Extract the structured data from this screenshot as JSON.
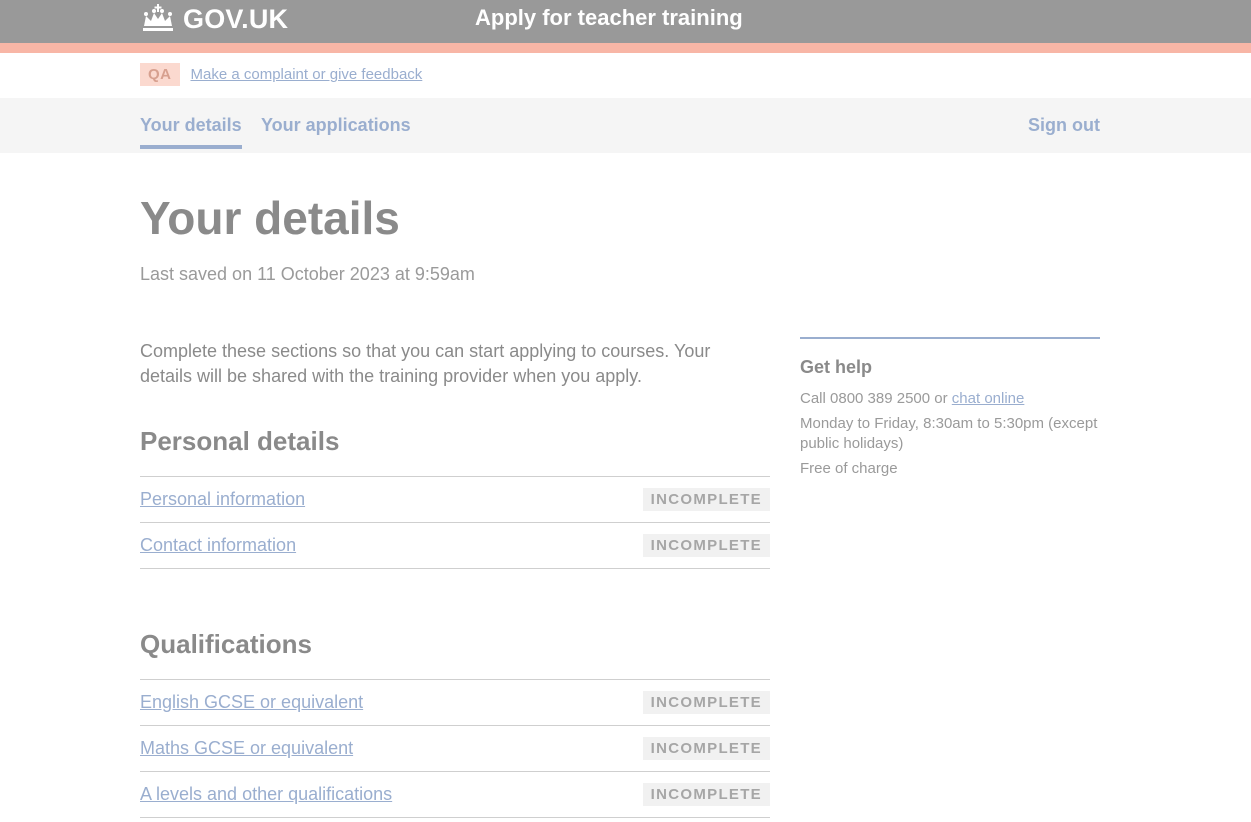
{
  "header": {
    "logo_text": "GOV.UK",
    "service_name": "Apply for teacher training",
    "crown_icon": "crown-icon"
  },
  "phase_banner": {
    "tag": "QA",
    "link": "Make a complaint or give feedback"
  },
  "nav": {
    "items": [
      {
        "label": "Your details",
        "active": true
      },
      {
        "label": "Your applications",
        "active": false
      }
    ],
    "sign_out": "Sign out"
  },
  "page": {
    "title": "Your details",
    "last_saved": "Last saved on 11 October 2023 at 9:59am",
    "intro": "Complete these sections so that you can start applying to courses. Your details will be shared with the training provider when you apply."
  },
  "sections": [
    {
      "heading": "Personal details",
      "tasks": [
        {
          "label": "Personal information",
          "status": "INCOMPLETE"
        },
        {
          "label": "Contact information",
          "status": "INCOMPLETE"
        }
      ]
    },
    {
      "heading": "Qualifications",
      "tasks": [
        {
          "label": "English GCSE or equivalent",
          "status": "INCOMPLETE"
        },
        {
          "label": "Maths GCSE or equivalent",
          "status": "INCOMPLETE"
        },
        {
          "label": "A levels and other qualifications",
          "status": "INCOMPLETE"
        }
      ]
    }
  ],
  "help": {
    "title": "Get help",
    "call_prefix": "Call 0800 389 2500 or",
    "chat_link": "chat online",
    "hours": "Monday to Friday, 8:30am to 5:30pm (except public holidays)",
    "cost": "Free of charge"
  },
  "colors": {
    "header": "#999999",
    "stripe": "#f8b6a6",
    "link": "#9aaecf"
  }
}
